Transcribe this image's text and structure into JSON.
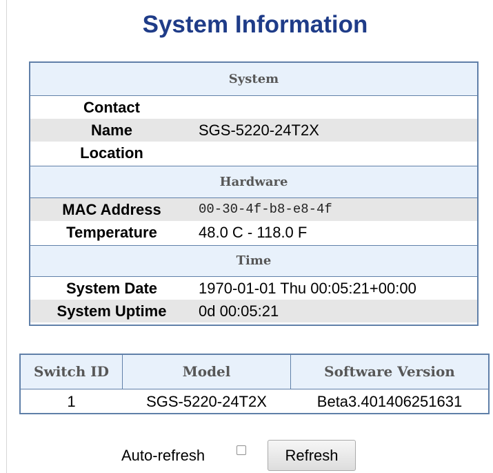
{
  "page": {
    "title": "System Information"
  },
  "system": {
    "header": "System",
    "rows": [
      {
        "label": "Contact",
        "value": ""
      },
      {
        "label": "Name",
        "value": "SGS-5220-24T2X"
      },
      {
        "label": "Location",
        "value": ""
      }
    ]
  },
  "hardware": {
    "header": "Hardware",
    "rows": [
      {
        "label": "MAC Address",
        "value": "00-30-4f-b8-e8-4f"
      },
      {
        "label": "Temperature",
        "value": "48.0 C - 118.0 F"
      }
    ]
  },
  "time": {
    "header": "Time",
    "rows": [
      {
        "label": "System Date",
        "value": "1970-01-01 Thu 00:05:21+00:00"
      },
      {
        "label": "System Uptime",
        "value": "0d 00:05:21"
      }
    ]
  },
  "switch_table": {
    "headers": [
      "Switch ID",
      "Model",
      "Software Version"
    ],
    "rows": [
      [
        "1",
        "SGS-5220-24T2X",
        "Beta3.401406251631"
      ]
    ]
  },
  "controls": {
    "auto_refresh_label": "Auto-refresh",
    "auto_refresh_checked": false,
    "refresh_label": "Refresh"
  },
  "colors": {
    "title": "#1f3c88",
    "header_bg": "#e8f1fb",
    "border": "#5f7fa8",
    "alt_row": "#e6e6e6"
  }
}
